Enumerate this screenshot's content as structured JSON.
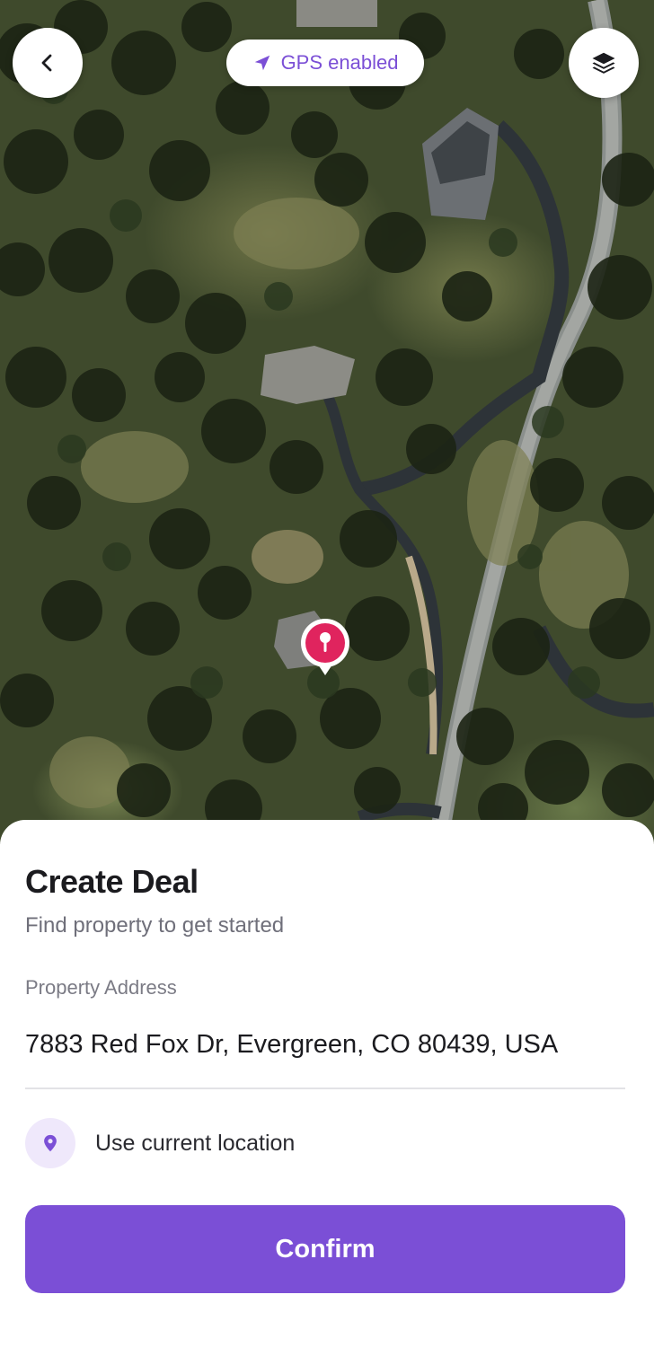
{
  "map": {
    "gps_status": "GPS enabled",
    "back_icon": "chevron-left-icon",
    "layers_icon": "layers-icon",
    "location_arrow_icon": "navigation-arrow-icon",
    "pin_icon": "map-pin-icon"
  },
  "sheet": {
    "title": "Create Deal",
    "subtitle": "Find property to get started",
    "address_label": "Property Address",
    "address_value": "7883 Red Fox Dr, Evergreen, CO 80439, USA",
    "use_location_label": "Use current location",
    "use_location_icon": "location-pin-icon",
    "confirm_label": "Confirm"
  },
  "colors": {
    "accent": "#7b4fd6",
    "accent_light": "#efe8fb",
    "pin": "#e0245e",
    "title_text": "#1b1b1f",
    "muted_text": "#6f6f7a"
  }
}
